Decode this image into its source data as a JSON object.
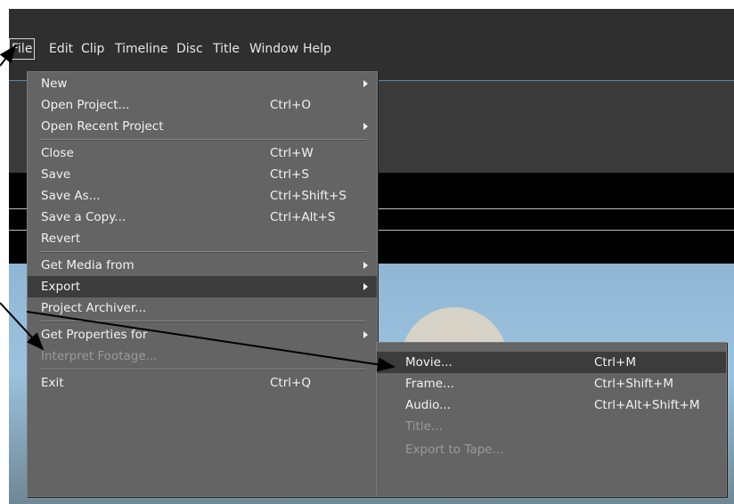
{
  "menubar": {
    "items": [
      "File",
      "Edit",
      "Clip",
      "Timeline",
      "Disc",
      "Title",
      "Window",
      "Help"
    ]
  },
  "file_menu": {
    "items": [
      {
        "label": "New",
        "shortcut": "",
        "submenu": true,
        "disabled": false
      },
      {
        "label": "Open Project...",
        "shortcut": "Ctrl+O",
        "submenu": false,
        "disabled": false
      },
      {
        "label": "Open Recent Project",
        "shortcut": "",
        "submenu": true,
        "disabled": false
      },
      {
        "label": "Close",
        "shortcut": "Ctrl+W",
        "submenu": false,
        "disabled": false
      },
      {
        "label": "Save",
        "shortcut": "Ctrl+S",
        "submenu": false,
        "disabled": false
      },
      {
        "label": "Save As...",
        "shortcut": "Ctrl+Shift+S",
        "submenu": false,
        "disabled": false
      },
      {
        "label": "Save a Copy...",
        "shortcut": "Ctrl+Alt+S",
        "submenu": false,
        "disabled": false
      },
      {
        "label": "Revert",
        "shortcut": "",
        "submenu": false,
        "disabled": false
      },
      {
        "label": "Get Media from",
        "shortcut": "",
        "submenu": true,
        "disabled": false
      },
      {
        "label": "Export",
        "shortcut": "",
        "submenu": true,
        "disabled": false,
        "selected": true
      },
      {
        "label": "Project Archiver...",
        "shortcut": "",
        "submenu": false,
        "disabled": false
      },
      {
        "label": "Get Properties for",
        "shortcut": "",
        "submenu": true,
        "disabled": false
      },
      {
        "label": "Interpret Footage...",
        "shortcut": "",
        "submenu": false,
        "disabled": true
      },
      {
        "label": "Exit",
        "shortcut": "Ctrl+Q",
        "submenu": false,
        "disabled": false
      }
    ]
  },
  "export_submenu": {
    "items": [
      {
        "label": "Movie...",
        "shortcut": "Ctrl+M",
        "disabled": false,
        "selected": true
      },
      {
        "label": "Frame...",
        "shortcut": "Ctrl+Shift+M",
        "disabled": false
      },
      {
        "label": "Audio...",
        "shortcut": "Ctrl+Alt+Shift+M",
        "disabled": false
      },
      {
        "label": "Title...",
        "shortcut": "",
        "disabled": true
      },
      {
        "label": "Export to Tape...",
        "shortcut": "",
        "disabled": true
      }
    ]
  },
  "colors": {
    "app_background": "#2f2f2f",
    "menu_background": "#646464",
    "menu_selected": "#3c3c3c",
    "menu_text": "#f2f2f2",
    "menu_disabled_text": "#9a9a9a",
    "annotation_arrow": "#000000"
  }
}
